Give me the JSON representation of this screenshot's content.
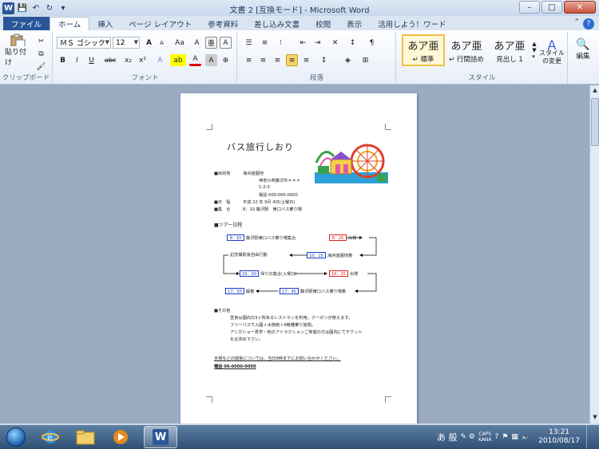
{
  "window": {
    "title": "文書 2 [互換モード] - Microsoft Word",
    "app_logo": "W"
  },
  "tabs": [
    "ファイル",
    "ホーム",
    "挿入",
    "ページ レイアウト",
    "参考資料",
    "差し込み文書",
    "校閲",
    "表示",
    "活用しよう！ワード"
  ],
  "ribbon": {
    "clipboard": {
      "paste": "貼り付け",
      "label": "クリップボード"
    },
    "font": {
      "name": "ＭＳ ゴシック",
      "size": "12",
      "label": "フォント",
      "bold": "B",
      "italic": "I",
      "underline": "U",
      "strike": "abc",
      "sub": "x₂",
      "sup": "x²",
      "grow": "A",
      "shrink": "A",
      "case": "Aa",
      "clear": "A",
      "color": "A",
      "highlight": "ab",
      "ruby": "亜",
      "enclose": "A"
    },
    "paragraph": {
      "label": "段落"
    },
    "styles": {
      "label": "スタイル",
      "items": [
        {
          "preview": "あア亜",
          "name": "↵ 標準"
        },
        {
          "preview": "あア亜",
          "name": "↵ 行間詰め"
        },
        {
          "preview": "あア亜",
          "name": "見出し 1"
        }
      ],
      "change": "スタイルの変更"
    },
    "editing": {
      "label": "編集"
    }
  },
  "document": {
    "title": "バス旅行しおり",
    "lines": [
      {
        "text": "■目的地　　　海浜遊園地"
      },
      {
        "text": "神奈川県藤沢市＊＊＊"
      },
      {
        "text": "1-2-3"
      },
      {
        "text": "電話 000-000-0000"
      },
      {
        "text": "■日　程　　　平成 22 年 9月 4日(土曜日)"
      },
      {
        "text": "■集　合　　　8：10 藤沢駅　東口バス乗り場"
      },
      {
        "text": "■ツアー日程"
      },
      {
        "text": "■その他"
      },
      {
        "text": "昼食は園内の3ヶ所あるレストランを利用。クーポンが使えます。"
      },
      {
        "text": "フリーパスで入園＋水族館＋9機種乗り放題。"
      },
      {
        "text": "アシカショー見学・他のアトラクションご希望の方は園内にてチケット"
      },
      {
        "text": "をお求め下さい。"
      },
      {
        "text": "天候などの関係については、当日9時までにお問い合わせください。"
      },
      {
        "text": "電話 00-0000-0000"
      }
    ],
    "flow": [
      {
        "time": "8：10",
        "label": "藤沢駅東口バス乗り場集合",
        "color": "blue"
      },
      {
        "time": "8：25",
        "label": "出発",
        "color": "red"
      },
      {
        "time": "10：10",
        "label": "海浜遊園地着",
        "color": "blue"
      },
      {
        "label": "記念撮影後自由行動"
      },
      {
        "time": "16：00",
        "label": "帰りの集合(入場口)",
        "color": "blue"
      },
      {
        "time": "16：15",
        "label": "出発",
        "color": "red"
      },
      {
        "time": "17：40",
        "label": "藤沢駅東口バス乗り場着",
        "color": "blue"
      },
      {
        "time": "17：50",
        "label": "解散",
        "color": "blue"
      }
    ]
  },
  "taskbar": {
    "ime": "あ 般",
    "caps": "CAPS",
    "kana": "KANA",
    "time": "13:21",
    "date": "2010/08/17"
  }
}
